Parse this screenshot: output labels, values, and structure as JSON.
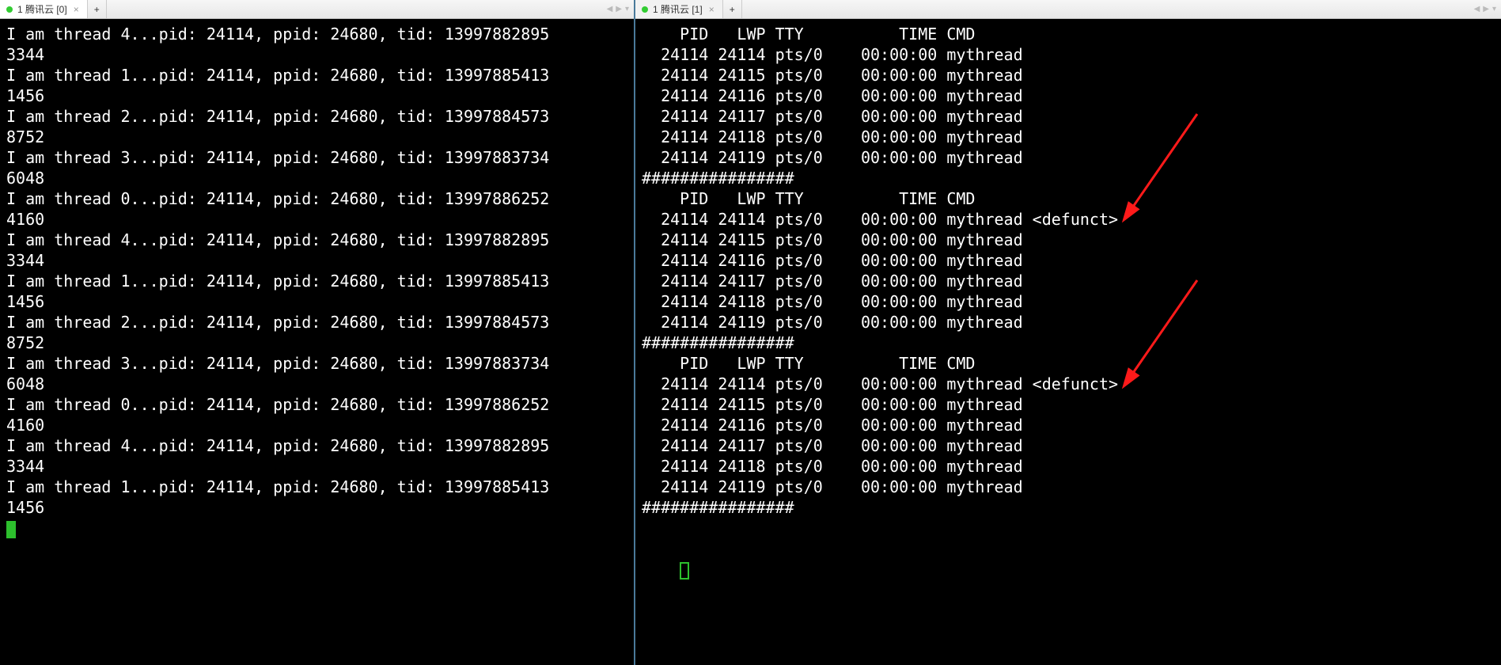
{
  "left": {
    "tab_title": "1 腾讯云 [0]",
    "lines": [
      "I am thread 4...pid: 24114, ppid: 24680, tid: 13997882895",
      "3344",
      "I am thread 1...pid: 24114, ppid: 24680, tid: 13997885413",
      "1456",
      "I am thread 2...pid: 24114, ppid: 24680, tid: 13997884573",
      "8752",
      "I am thread 3...pid: 24114, ppid: 24680, tid: 13997883734",
      "6048",
      "I am thread 0...pid: 24114, ppid: 24680, tid: 13997886252",
      "4160",
      "I am thread 4...pid: 24114, ppid: 24680, tid: 13997882895",
      "3344",
      "I am thread 1...pid: 24114, ppid: 24680, tid: 13997885413",
      "1456",
      "I am thread 2...pid: 24114, ppid: 24680, tid: 13997884573",
      "8752",
      "I am thread 3...pid: 24114, ppid: 24680, tid: 13997883734",
      "6048",
      "I am thread 0...pid: 24114, ppid: 24680, tid: 13997886252",
      "4160",
      "I am thread 4...pid: 24114, ppid: 24680, tid: 13997882895",
      "3344",
      "I am thread 1...pid: 24114, ppid: 24680, tid: 13997885413",
      "1456"
    ]
  },
  "right": {
    "tab_title": "1 腾讯云 [1]",
    "lines": [
      "    PID   LWP TTY          TIME CMD",
      "  24114 24114 pts/0    00:00:00 mythread",
      "  24114 24115 pts/0    00:00:00 mythread",
      "  24114 24116 pts/0    00:00:00 mythread",
      "  24114 24117 pts/0    00:00:00 mythread",
      "  24114 24118 pts/0    00:00:00 mythread",
      "  24114 24119 pts/0    00:00:00 mythread",
      "################",
      "    PID   LWP TTY          TIME CMD",
      "  24114 24114 pts/0    00:00:00 mythread <defunct>",
      "  24114 24115 pts/0    00:00:00 mythread",
      "  24114 24116 pts/0    00:00:00 mythread",
      "  24114 24117 pts/0    00:00:00 mythread",
      "  24114 24118 pts/0    00:00:00 mythread",
      "  24114 24119 pts/0    00:00:00 mythread",
      "################",
      "    PID   LWP TTY          TIME CMD",
      "  24114 24114 pts/0    00:00:00 mythread <defunct>",
      "  24114 24115 pts/0    00:00:00 mythread",
      "  24114 24116 pts/0    00:00:00 mythread",
      "  24114 24117 pts/0    00:00:00 mythread",
      "  24114 24118 pts/0    00:00:00 mythread",
      "  24114 24119 pts/0    00:00:00 mythread",
      "################"
    ]
  },
  "icons": {
    "close": "×",
    "add": "+",
    "tri_left": "◀",
    "tri_right": "▶",
    "menu": "▾"
  }
}
